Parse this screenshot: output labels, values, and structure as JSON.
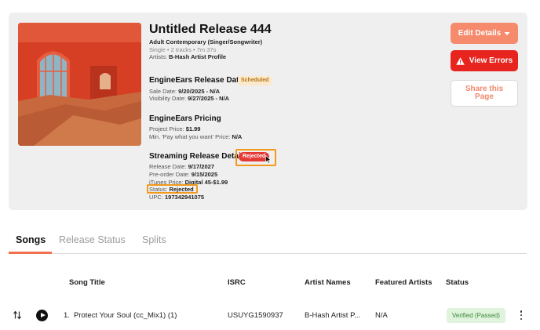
{
  "release": {
    "title": "Untitled Release 444",
    "genre": "Adult Contemporary (Singer/Songwriter)",
    "meta": "Single • 2 tracks • 7m 37s",
    "artists_label": "Artists:",
    "artists_value": "B-Hash Artist Profile"
  },
  "release_dates": {
    "heading": "EngineEars Release Dates",
    "badge": "Scheduled",
    "sale_label": "Sale Date:",
    "sale_value": "9/20/2025 - N/A",
    "visibility_label": "Visibility Date:",
    "visibility_value": "9/27/2025 - N/A"
  },
  "pricing": {
    "heading": "EngineEars Pricing",
    "project_label": "Project Price:",
    "project_value": "$1.99",
    "min_label": "Min. 'Pay what you want' Price:",
    "min_value": "N/A"
  },
  "streaming": {
    "heading": "Streaming Release Details",
    "badge": "Rejected",
    "release_label": "Release Date:",
    "release_value": "9/17/2027",
    "preorder_label": "Pre-order Date:",
    "preorder_value": "9/15/2025",
    "itunes_label": "iTunes Price:",
    "itunes_value": "Digital 45-$1.99",
    "status_label": "Status:",
    "status_value": "Rejected",
    "upc_label": "UPC:",
    "upc_value": "197342941075"
  },
  "actions": {
    "edit": "Edit Details",
    "errors": "View Errors",
    "share": "Share this Page"
  },
  "tabs": [
    "Songs",
    "Release Status",
    "Splits"
  ],
  "table": {
    "columns": [
      "Song Title",
      "ISRC",
      "Artist Names",
      "Featured Artists",
      "Status"
    ],
    "rows": [
      {
        "index": "1.",
        "title": "Protect Your Soul (cc_Mix1) (1)",
        "isrc": "USUYG1590937",
        "artist": "B-Hash Artist P...",
        "featured": "N/A",
        "status": "Verified (Passed)"
      }
    ]
  },
  "colors": {
    "accent": "#f58a6c",
    "danger": "#e8241f",
    "highlight": "#f39a1c",
    "verified_bg": "#dff3dd",
    "verified_text": "#3d8b3a"
  },
  "icons": [
    "chevron-down-icon",
    "warning-icon",
    "cursor-icon",
    "sort-icon",
    "play-icon",
    "more-vertical-icon"
  ]
}
